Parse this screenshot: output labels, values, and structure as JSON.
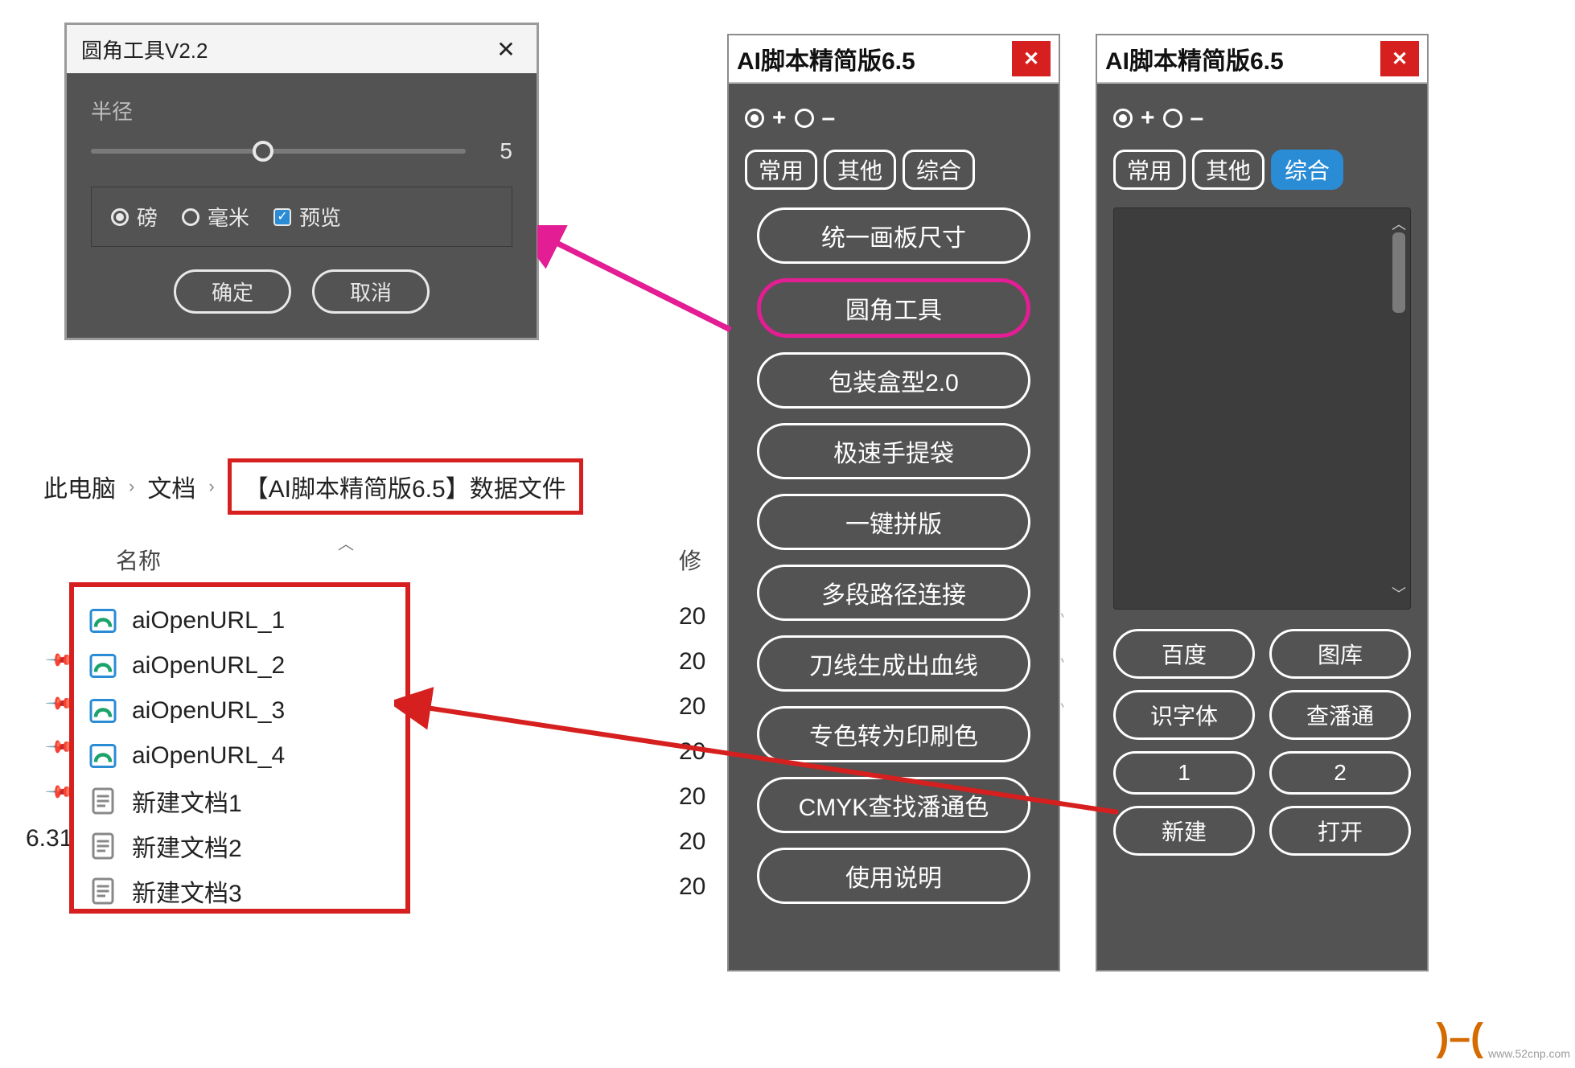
{
  "dialog": {
    "title": "圆角工具V2.2",
    "radius_label": "半径",
    "radius_value": "5",
    "unit_pound": "磅",
    "unit_mm": "毫米",
    "preview": "预览",
    "ok": "确定",
    "cancel": "取消"
  },
  "breadcrumb": {
    "root": "此电脑",
    "level1": "文档",
    "level2": "【AI脚本精简版6.5】数据文件"
  },
  "columns": {
    "name": "名称",
    "modified": "修"
  },
  "side_version": "6.31",
  "files": [
    {
      "name": "aiOpenURL_1",
      "type": "edge",
      "date": "20"
    },
    {
      "name": "aiOpenURL_2",
      "type": "edge",
      "date": "20"
    },
    {
      "name": "aiOpenURL_3",
      "type": "edge",
      "date": "20"
    },
    {
      "name": "aiOpenURL_4",
      "type": "edge",
      "date": "20"
    },
    {
      "name": "新建文档1",
      "type": "txt",
      "date": "20"
    },
    {
      "name": "新建文档2",
      "type": "txt",
      "date": "20"
    },
    {
      "name": "新建文档3",
      "type": "txt",
      "date": "20"
    }
  ],
  "faint_glyphs": [
    "忄",
    "忄",
    "忄"
  ],
  "panel_a": {
    "title": "AI脚本精简版6.5",
    "plus": "+",
    "minus": "–",
    "tabs": [
      "常用",
      "其他",
      "综合"
    ],
    "active_tab": 0,
    "buttons": [
      "统一画板尺寸",
      "圆角工具",
      "包装盒型2.0",
      "极速手提袋",
      "一键拼版",
      "多段路径连接",
      "刀线生成出血线",
      "专色转为印刷色",
      "CMYK查找潘通色",
      "使用说明"
    ],
    "highlight_index": 1
  },
  "panel_b": {
    "title": "AI脚本精简版6.5",
    "plus": "+",
    "minus": "–",
    "tabs": [
      "常用",
      "其他",
      "综合"
    ],
    "active_tab": 2,
    "buttons": [
      "百度",
      "图库",
      "识字体",
      "查潘通",
      "1",
      "2",
      "新建",
      "打开"
    ]
  },
  "colors": {
    "panel_bg": "#535353",
    "accent_red": "#d6201f",
    "accent_pink": "#e31d93",
    "accent_blue": "#2b8cd6"
  },
  "watermark": {
    "site": "www.52cnp.com"
  }
}
